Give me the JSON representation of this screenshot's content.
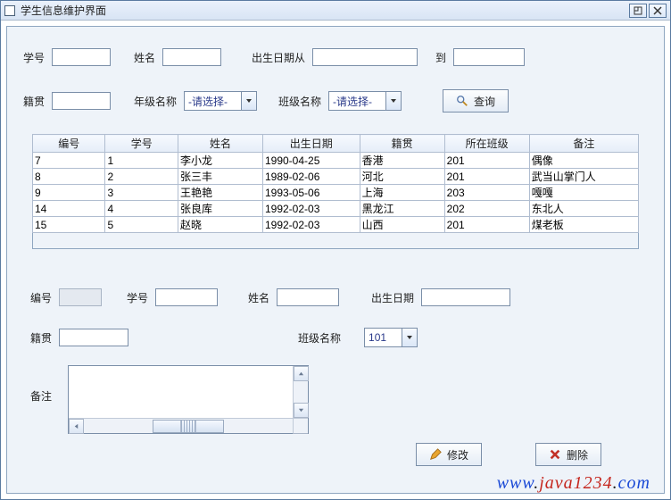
{
  "window": {
    "title": "学生信息维护界面"
  },
  "search": {
    "labels": {
      "student_no": "学号",
      "name": "姓名",
      "birth_from": "出生日期从",
      "birth_to": "到",
      "native_place": "籍贯",
      "grade_name": "年级名称",
      "class_name": "班级名称"
    },
    "grade_placeholder": "-请选择-",
    "class_placeholder": "-请选择-",
    "query_btn": "查询"
  },
  "table": {
    "headers": [
      "编号",
      "学号",
      "姓名",
      "出生日期",
      "籍贯",
      "所在班级",
      "备注"
    ],
    "rows": [
      {
        "c": [
          "7",
          "1",
          "李小龙",
          "1990-04-25",
          "香港",
          "201",
          "偶像"
        ]
      },
      {
        "c": [
          "8",
          "2",
          "张三丰",
          "1989-02-06",
          "河北",
          "201",
          "武当山掌门人"
        ]
      },
      {
        "c": [
          "9",
          "3",
          "王艳艳",
          "1993-05-06",
          "上海",
          "203",
          "嘎嘎"
        ]
      },
      {
        "c": [
          "14",
          "4",
          "张良库",
          "1992-02-03",
          "黑龙江",
          "202",
          "东北人"
        ]
      },
      {
        "c": [
          "15",
          "5",
          "赵晓",
          "1992-02-03",
          "山西",
          "201",
          "煤老板"
        ]
      }
    ]
  },
  "detail": {
    "labels": {
      "id": "编号",
      "student_no": "学号",
      "name": "姓名",
      "birth": "出生日期",
      "native_place": "籍贯",
      "class_name": "班级名称",
      "remark": "备注"
    },
    "class_value": "101",
    "modify_btn": "修改",
    "delete_btn": "删除"
  },
  "watermark": {
    "p1": "www",
    "p2": ".",
    "p3": "java1234",
    "p4": ".",
    "p5": "com"
  }
}
